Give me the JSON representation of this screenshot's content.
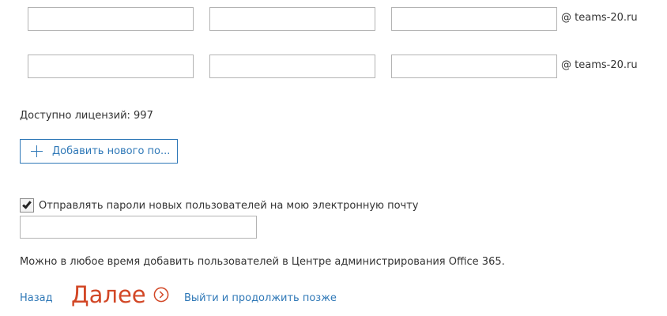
{
  "users": {
    "rows": [
      {
        "first_name": "",
        "last_name": "",
        "username": "",
        "domain": "@ teams-20.ru"
      },
      {
        "first_name": "",
        "last_name": "",
        "username": "",
        "domain": "@ teams-20.ru"
      }
    ]
  },
  "licenses": {
    "text": "Доступно лицензий: 997"
  },
  "add_user": {
    "label": "Добавить нового по...",
    "icon": "plus-icon"
  },
  "send_passwords": {
    "checked": true,
    "label": "Отправлять пароли новых пользователей на мою электронную почту",
    "email_value": ""
  },
  "info": {
    "text": "Можно в любое время добавить пользователей в Центре администрирования Office 365."
  },
  "footer": {
    "back_label": "Назад",
    "next_label": "Далее",
    "next_icon": "chevron-right-circle-icon",
    "later_label": "Выйти и продолжить позже"
  },
  "colors": {
    "link": "#2f78b7",
    "accent": "#d24726",
    "text": "#333333",
    "border": "#b3b3b3"
  }
}
